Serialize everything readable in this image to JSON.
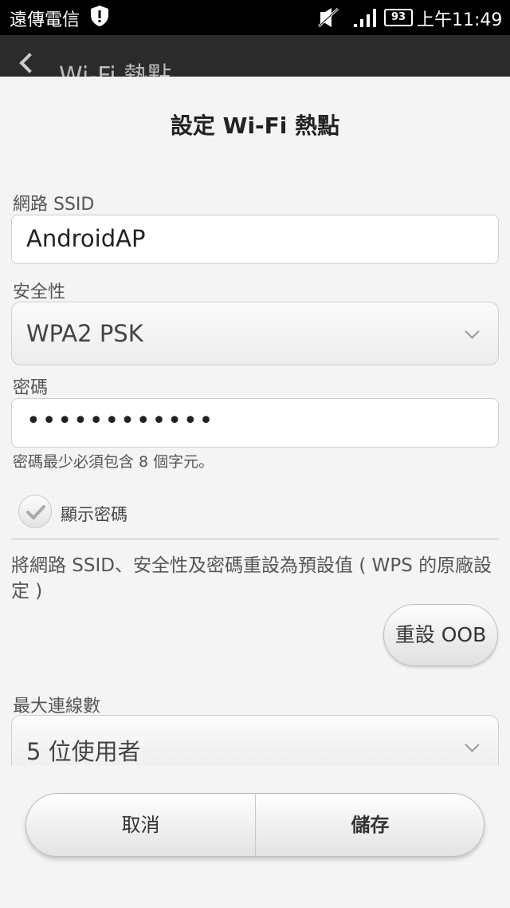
{
  "status_bar": {
    "carrier": "遠傳電信",
    "battery": "93",
    "time": "上午11:49"
  },
  "app_bar": {
    "title": "Wi-Fi 熱點"
  },
  "dialog": {
    "title": "設定 Wi-Fi 熱點",
    "ssid_label": "網路 SSID",
    "ssid_value": "AndroidAP",
    "security_label": "安全性",
    "security_value": "WPA2 PSK",
    "password_label": "密碼",
    "password_value": "••••••••••••",
    "password_hint": "密碼最少必須包含 8 個字元。",
    "show_password_label": "顯示密碼",
    "show_password_checked": true,
    "reset_description": "將網路 SSID、安全性及密碼重設為預設值 ( WPS 的原廠設定 )",
    "reset_button": "重設 OOB",
    "max_connections_label": "最大連線數",
    "max_connections_value": "5 位使用者",
    "cancel_button": "取消",
    "save_button": "儲存"
  },
  "colors": {
    "status_bar_bg": "#000000",
    "dialog_bg": "#f4f4f4",
    "text_dark": "#222222"
  }
}
